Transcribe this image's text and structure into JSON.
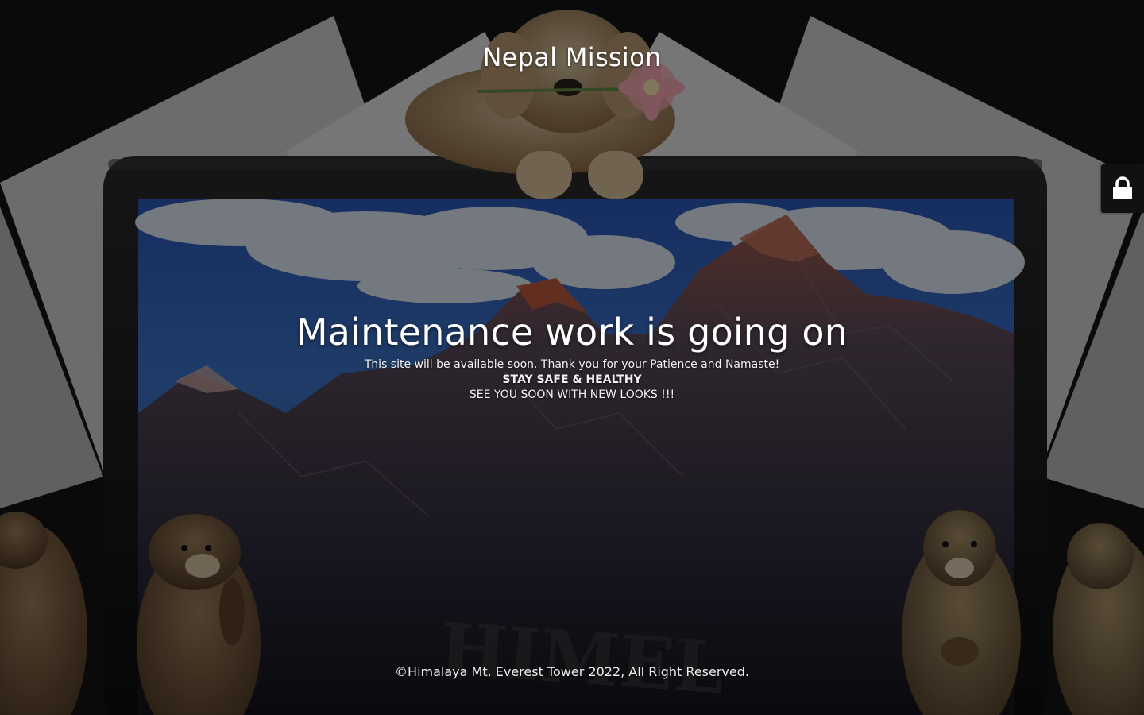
{
  "header": {
    "site_title": "Nepal Mission"
  },
  "main": {
    "headline": "Maintenance work is going on",
    "message_lines": [
      "This site will be available soon. Thank you for your Patience and Namaste!",
      "STAY SAFE & HEALTHY",
      "SEE YOU SOON WITH NEW LOOKS !!!"
    ]
  },
  "footer": {
    "copyright": "©Himalaya Mt. Everest Tower 2022, All Right Reserved."
  },
  "login": {
    "icon": "lock-icon"
  },
  "colors": {
    "overlay": "#000000",
    "text": "#ffffff",
    "login_tab": "#111111"
  }
}
